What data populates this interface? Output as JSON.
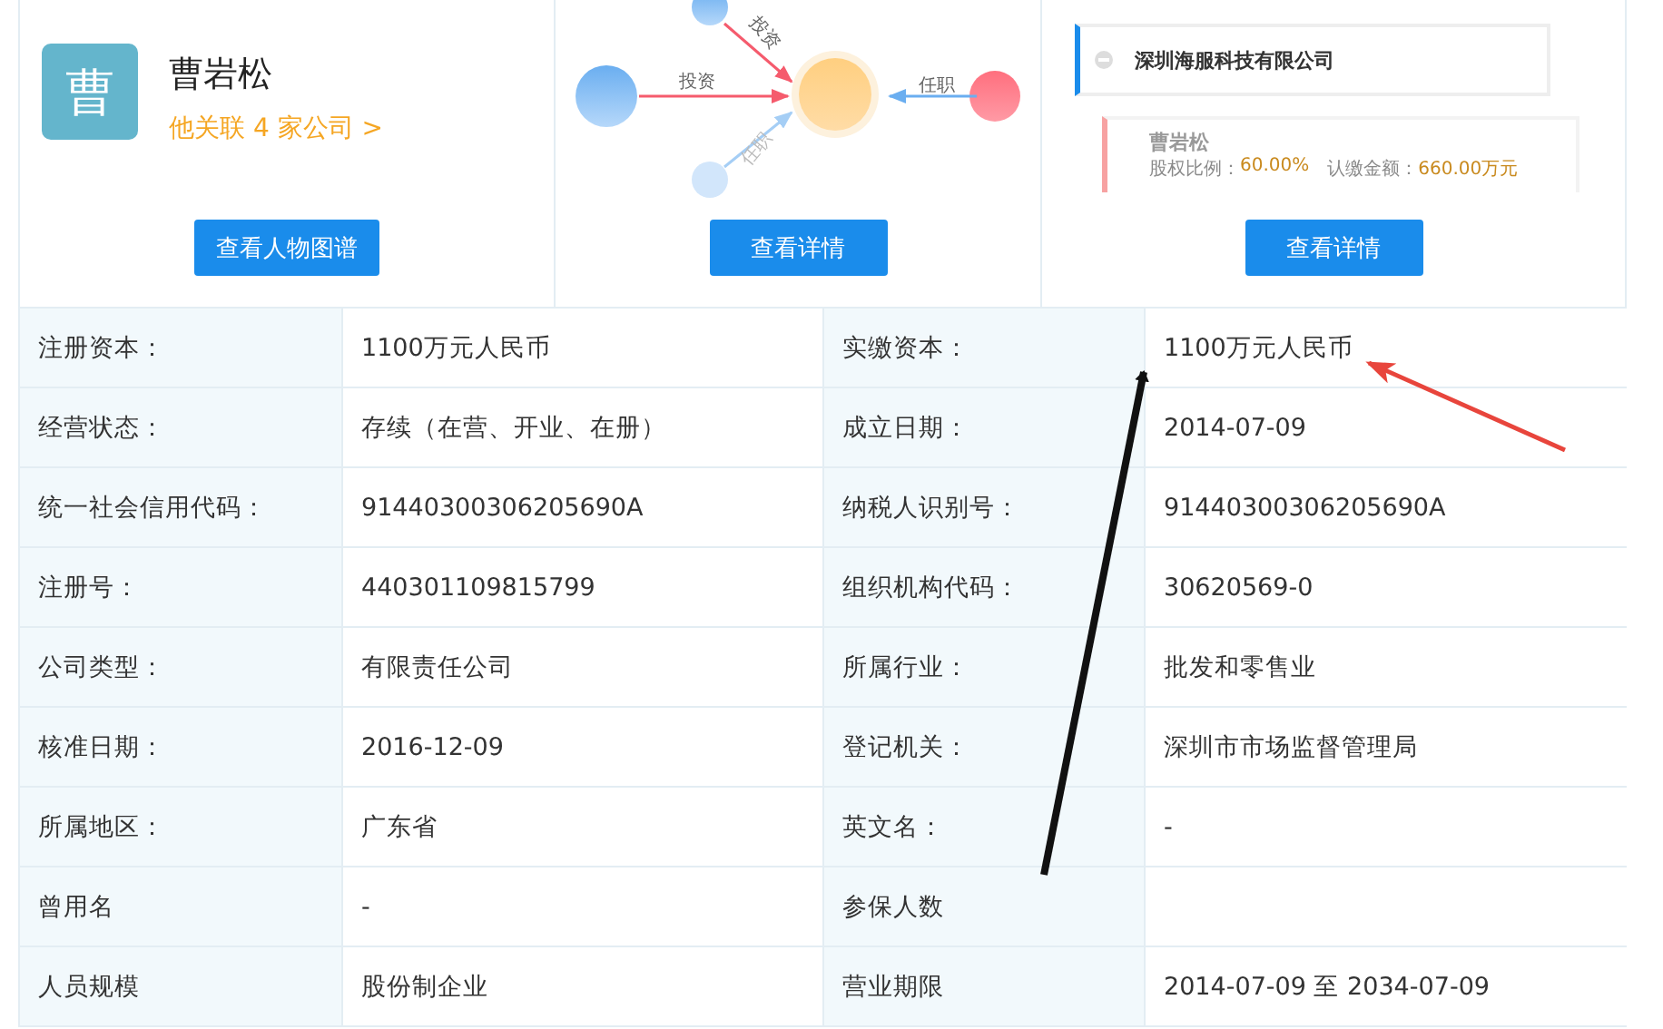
{
  "person": {
    "avatar_char": "曹",
    "name": "曹岩松",
    "related_link": "他关联 4 家公司 >",
    "button": "查看人物图谱"
  },
  "graph_preview": {
    "edges": [
      {
        "label": "投资",
        "kind": "invest"
      },
      {
        "label": "投资",
        "kind": "invest"
      },
      {
        "label": "任职",
        "kind": "post"
      },
      {
        "label": "任职",
        "kind": "post"
      }
    ],
    "button": "查看详情"
  },
  "tree_preview": {
    "company": "深圳海服科技有限公司",
    "shareholder": "曹岩松",
    "ratio_label": "股权比例：",
    "ratio": "60.00%",
    "amount_label": "认缴金额：",
    "amount": "660.00万元",
    "button": "查看详情"
  },
  "info_table": {
    "rows": [
      [
        "注册资本：",
        "1100万元人民币",
        "实缴资本：",
        "1100万元人民币"
      ],
      [
        "经营状态：",
        "存续（在营、开业、在册）",
        "成立日期：",
        "2014-07-09"
      ],
      [
        "统一社会信用代码：",
        "91440300306205690A",
        "纳税人识别号：",
        "91440300306205690A"
      ],
      [
        "注册号：",
        "440301109815799",
        "组织机构代码：",
        "30620569-0"
      ],
      [
        "公司类型：",
        "有限责任公司",
        "所属行业：",
        "批发和零售业"
      ],
      [
        "核准日期：",
        "2016-12-09",
        "登记机关：",
        "深圳市市场监督管理局"
      ],
      [
        "所属地区：",
        "广东省",
        "英文名：",
        "-"
      ],
      [
        "曾用名",
        "-",
        "参保人数",
        ""
      ],
      [
        "人员规模",
        "股份制企业",
        "营业期限",
        "2014-07-09 至 2034-07-09"
      ]
    ]
  }
}
